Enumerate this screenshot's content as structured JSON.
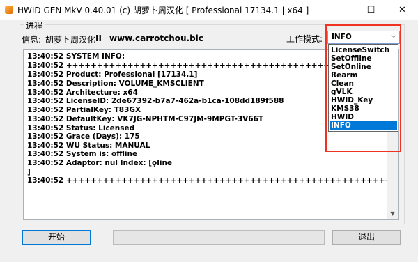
{
  "window": {
    "title": "HWID GEN MkV 0.40.01 (c) 胡萝卜周汉化 [ Professional 17134.1 | x64 ]",
    "minimize_glyph": "—",
    "maximize_glyph": "☐",
    "close_glyph": "✕"
  },
  "group": {
    "label": "进程"
  },
  "info": {
    "label": "信息:",
    "value": "胡萝卜周汉化",
    "separator": "II",
    "url": "www.carrotchou.blc"
  },
  "mode": {
    "label": "工作模式:",
    "selected": "INFO",
    "options": [
      "LicenseSwitch",
      "SetOffline",
      "SetOnline",
      "Rearm",
      "Clean",
      "gVLK",
      "HWID_Key",
      "KMS38",
      "HWID",
      "INFO"
    ]
  },
  "log": {
    "lines": [
      "13:40:52 SYSTEM INFO:",
      "13:40:52 +++++++++++++++++++++++++++++++++++++++++++++++++++++++++++++++++++++++++++++++++",
      "13:40:52 Product: Professional [17134.1]",
      "13:40:52 Description: VOLUME_KMSCLIENT",
      "13:40:52 Architecture: x64",
      "13:40:52 LicenseID: 2de67392-b7a7-462a-b1ca-108dd189f588",
      "13:40:52 PartialKey: T83GX",
      "13:40:52 DefaultKey: VK7JG-NPHTM-C97JM-9MPGT-3V66T",
      "13:40:52 Status: Licensed",
      "13:40:52 Grace (Days): 175",
      "13:40:52 WU Status: MANUAL",
      "13:40:52 System is: offline",
      "13:40:52 Adaptor: nul Index: [ǫline",
      "]",
      "13:40:52 +++++++++++++++++++++++++++++++++++++++++++++++++++++++++++++++++++++++++++++++++"
    ]
  },
  "buttons": {
    "start": "开始",
    "exit": "退出"
  },
  "progress": {
    "value": 0
  },
  "colors": {
    "selection": "#0078d7",
    "highlight_box": "#ee3322"
  }
}
